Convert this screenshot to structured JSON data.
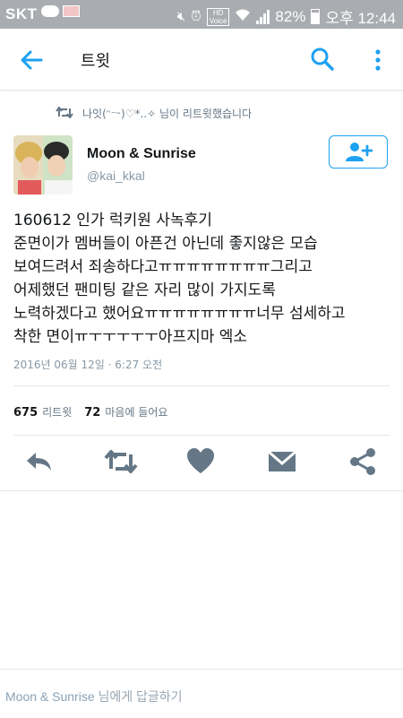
{
  "status_bar": {
    "carrier": "SKT",
    "hd_label": "HD\nVoice",
    "battery": "82%",
    "time": "오후 12:44"
  },
  "app_bar": {
    "title": "트윗"
  },
  "retweet_notice": "나잇(ᵔ⁻ᵕ)♡*..✧ 님이 리트윗했습니다",
  "author": {
    "name": "Moon & Sunrise",
    "handle": "@kai_kkal"
  },
  "tweet": {
    "text": "160612 인가 럭키원 사녹후기\n준면이가 멤버들이 아픈건 아닌데 좋지않은 모습\n보여드려서 죄송하다고ㅠㅠㅠㅠㅠㅠㅠㅠ그리고\n어제했던 팬미팅 같은 자리 많이 가지도록\n노력하겠다고 했어요ㅠㅠㅠㅠㅠㅠㅠㅠ너무 섬세하고\n착한 면이ㅠㅜㅜㅜㅜㅜ아프지마 엑소",
    "timestamp": "2016년 06월 12일 · 6:27 오전"
  },
  "stats": {
    "retweets_count": "675",
    "retweets_label": "리트윗",
    "likes_count": "72",
    "likes_label": "마음에 들어요"
  },
  "reply": {
    "placeholder_name": "Moon & Sunrise",
    "placeholder_suffix": " 님에게 답글하기"
  },
  "icons": {
    "back": "arrow-left-icon",
    "search": "search-icon",
    "more": "more-vertical-icon",
    "retweet": "retweet-icon",
    "reply": "reply-icon",
    "like": "heart-icon",
    "dm": "envelope-icon",
    "share": "share-icon",
    "follow": "add-user-icon"
  },
  "colors": {
    "accent": "#1da1f2",
    "action_gray": "#657786",
    "status_bar": "#a9acb0"
  }
}
